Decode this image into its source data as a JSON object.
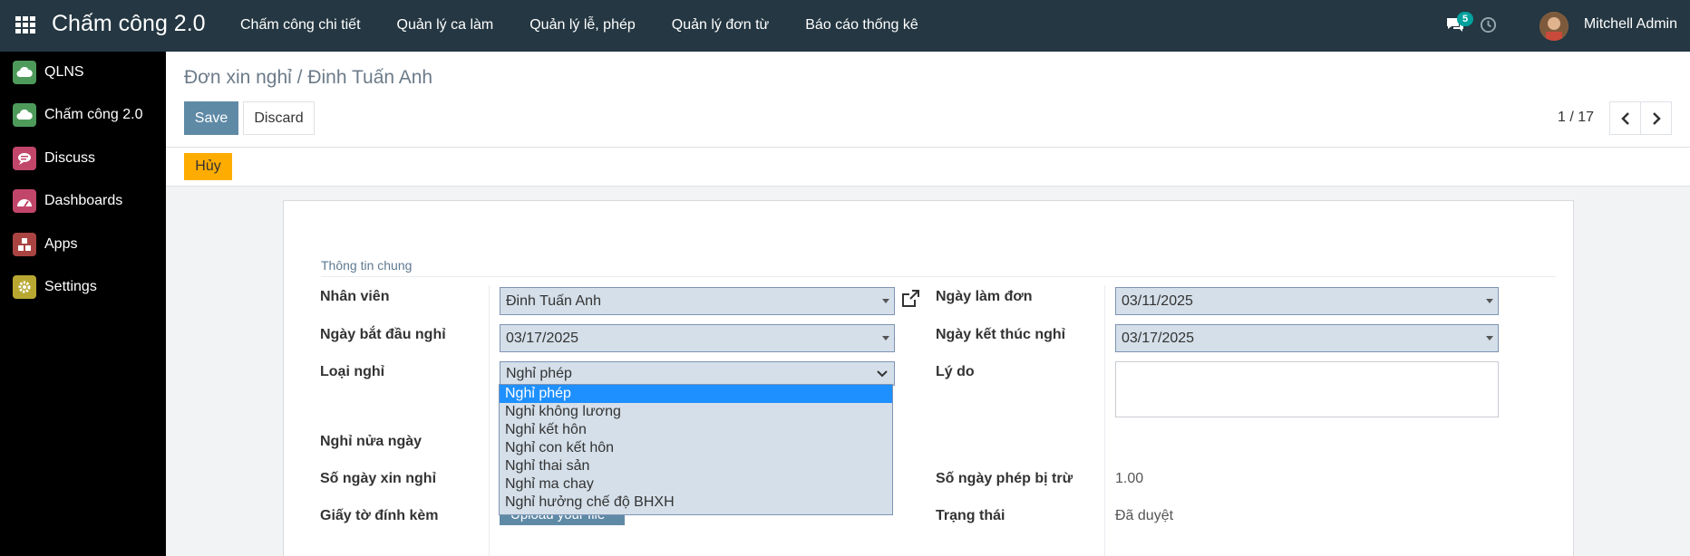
{
  "navbar": {
    "brand": "Chấm công 2.0",
    "menu": [
      "Chấm công chi tiết",
      "Quản lý ca làm",
      "Quản lý lễ, phép",
      "Quản lý đơn từ",
      "Báo cáo thống kê"
    ],
    "message_count": "5",
    "user_name": "Mitchell Admin"
  },
  "sidebar": {
    "items": [
      {
        "label": "QLNS",
        "icon": "cloud-icon",
        "color": "#4e9a5b"
      },
      {
        "label": "Chấm công 2.0",
        "icon": "cloud-icon",
        "color": "#4e9a5b"
      },
      {
        "label": "Discuss",
        "icon": "chat-bubble-icon",
        "color": "#c2466a"
      },
      {
        "label": "Dashboards",
        "icon": "gauge-icon",
        "color": "#c2466a"
      },
      {
        "label": "Apps",
        "icon": "cubes-icon",
        "color": "#a94442"
      },
      {
        "label": "Settings",
        "icon": "gear-icon",
        "color": "#b8a832"
      }
    ]
  },
  "control": {
    "breadcrumb": "Đơn xin nghỉ / Đinh Tuấn Anh",
    "save_label": "Save",
    "discard_label": "Discard",
    "pager": "1 / 17"
  },
  "statusbar": {
    "cancel_label": "Hủy"
  },
  "form": {
    "group_title": "Thông tin chung",
    "employee_label": "Nhân viên",
    "employee_value": "Đinh Tuấn Anh",
    "request_date_label": "Ngày làm đơn",
    "request_date_value": "03/11/2025",
    "start_date_label": "Ngày bắt đầu nghỉ",
    "start_date_value": "03/17/2025",
    "end_date_label": "Ngày kết thúc nghỉ",
    "end_date_value": "03/17/2025",
    "leave_type_label": "Loại nghỉ",
    "leave_type_value": "Nghỉ phép",
    "reason_label": "Lý do",
    "half_day_label": "Nghỉ nửa ngày",
    "days_label": "Số ngày xin nghỉ",
    "deducted_label": "Số ngày phép bị trừ",
    "deducted_value": "1.00",
    "attachment_label": "Giấy tờ đính kèm",
    "upload_label": "Upload your file",
    "state_label": "Trạng thái",
    "state_value": "Đã duyệt"
  },
  "leave_type_options": [
    "Nghỉ phép",
    "Nghỉ không lương",
    "Nghỉ kết hôn",
    "Nghỉ con kết hôn",
    "Nghỉ thai sản",
    "Nghỉ ma chay",
    "Nghỉ hưởng chế độ BHXH"
  ],
  "colors": {
    "navbar": "#243742",
    "primary": "#5f8aa6",
    "cancel": "#ffac00",
    "field_bg": "#d4dfe9",
    "highlight": "#1e90ff"
  }
}
